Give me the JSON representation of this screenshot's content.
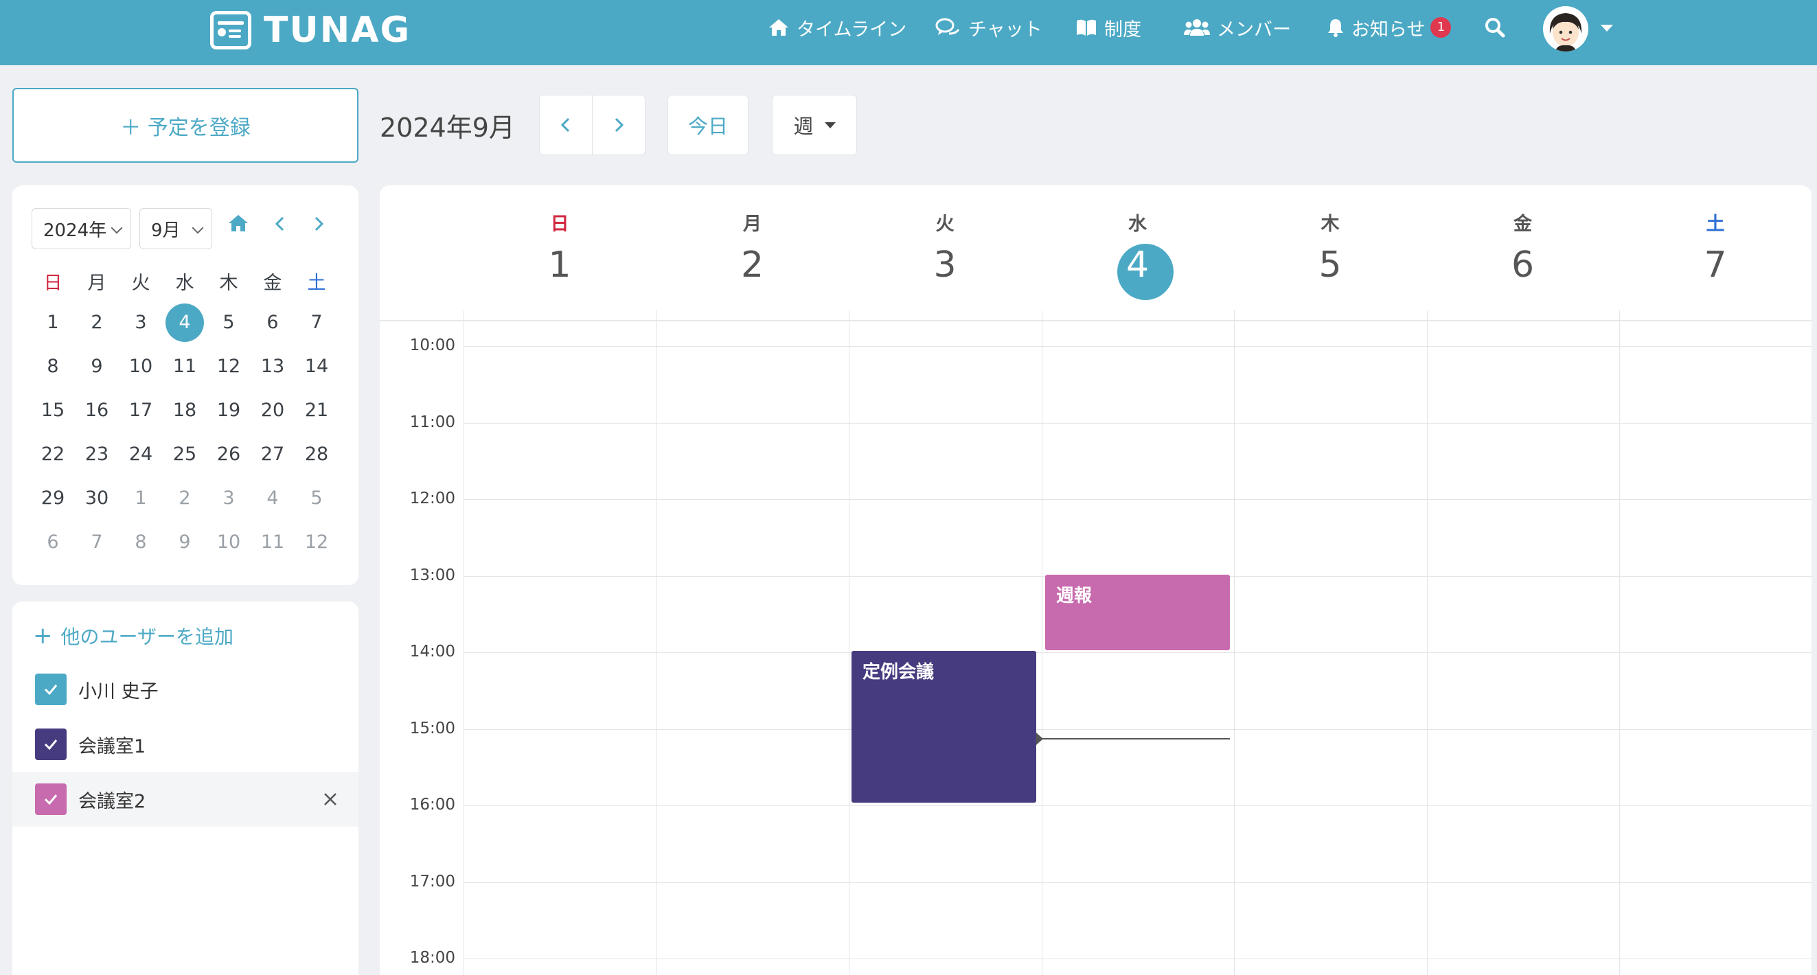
{
  "header": {
    "logo_text": "TUNAG",
    "nav": [
      {
        "label": "タイムライン",
        "icon": "home-icon"
      },
      {
        "label": "チャット",
        "icon": "chat-icon"
      },
      {
        "label": "制度",
        "icon": "book-icon"
      },
      {
        "label": "メンバー",
        "icon": "members-icon"
      },
      {
        "label": "お知らせ",
        "icon": "bell-icon",
        "badge": "1"
      }
    ],
    "brand_color": "#4ca9c5"
  },
  "sidebar": {
    "create_label": "＋ 予定を登録",
    "year_select": "2024年",
    "month_select": "9月",
    "weekdays": [
      "日",
      "月",
      "火",
      "水",
      "木",
      "金",
      "土"
    ],
    "weeks": [
      [
        "1",
        "2",
        "3",
        "4",
        "5",
        "6",
        "7"
      ],
      [
        "8",
        "9",
        "10",
        "11",
        "12",
        "13",
        "14"
      ],
      [
        "15",
        "16",
        "17",
        "18",
        "19",
        "20",
        "21"
      ],
      [
        "22",
        "23",
        "24",
        "25",
        "26",
        "27",
        "28"
      ],
      [
        "29",
        "30",
        "1",
        "2",
        "3",
        "4",
        "5"
      ],
      [
        "6",
        "7",
        "8",
        "9",
        "10",
        "11",
        "12"
      ]
    ],
    "today": "4",
    "add_user_label": "他のユーザーを追加",
    "users": [
      {
        "label": "小川 史子",
        "color": "#4ca9c5",
        "checked": true
      },
      {
        "label": "会議室1",
        "color": "#473b7f",
        "checked": true
      },
      {
        "label": "会議室2",
        "color": "#c86aae",
        "checked": true
      }
    ]
  },
  "toolbar": {
    "month_title": "2024年9月",
    "today_label": "今日",
    "view_label": "週"
  },
  "week": {
    "days": [
      {
        "dow": "日",
        "num": "1",
        "color": "#d0283f"
      },
      {
        "dow": "月",
        "num": "2"
      },
      {
        "dow": "火",
        "num": "3"
      },
      {
        "dow": "水",
        "num": "4",
        "today": true
      },
      {
        "dow": "木",
        "num": "5"
      },
      {
        "dow": "金",
        "num": "6"
      },
      {
        "dow": "土",
        "num": "7",
        "color": "#2f6fd6"
      }
    ],
    "times": [
      "10:00",
      "11:00",
      "12:00",
      "13:00",
      "14:00",
      "15:00",
      "16:00",
      "17:00",
      "18:00"
    ],
    "events": [
      {
        "title": "週報",
        "color": "#c86aae",
        "day": "水",
        "start": "13:00",
        "end": "14:00"
      },
      {
        "title": "定例会議",
        "color": "#473b7f",
        "day": "火",
        "start": "14:00",
        "end": "16:00"
      }
    ]
  }
}
